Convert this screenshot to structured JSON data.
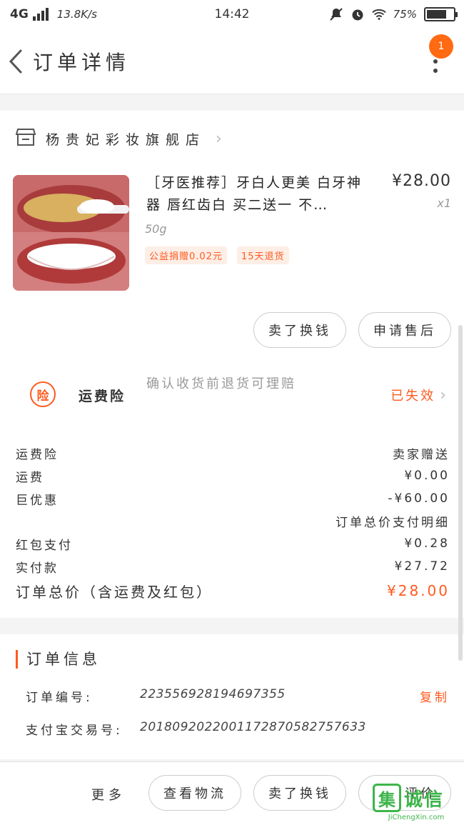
{
  "status_bar": {
    "network": "4G",
    "speed": "13.8K/s",
    "time": "14:42",
    "battery": "75%",
    "battery_level": 0.75
  },
  "header": {
    "title": "订单详情",
    "badge_count": "1",
    "accent": "#ff6a12"
  },
  "shop": {
    "name": "杨贵妃彩妆旗舰店"
  },
  "product": {
    "title": "［牙医推荐］牙白人更美 白牙神器 唇红齿白 买二送一 不…",
    "price": "¥28.00",
    "qty": "x1",
    "spec": "50g",
    "tags": [
      "公益捐赠0.02元",
      "15天退货"
    ]
  },
  "actions": {
    "sell_swap": "卖了换钱",
    "after_sale": "申请售后"
  },
  "insurance": {
    "icon_label": "险",
    "label": "运费险",
    "desc": "确认收货前退货可理赔",
    "status": "已失效"
  },
  "summary": {
    "rows": [
      {
        "label": "运费险",
        "value": "卖家赠送"
      },
      {
        "label": "运费",
        "value": "¥0.00"
      },
      {
        "label": "巨优惠",
        "value": "-¥60.00"
      }
    ],
    "detail_link": "订单总价支付明细",
    "rows2": [
      {
        "label": "红包支付",
        "value": "¥0.28"
      },
      {
        "label": "实付款",
        "value": "¥27.72"
      }
    ],
    "total_label": "订单总价（含运费及红包）",
    "total_value": "¥28.00"
  },
  "order_info": {
    "title": "订单信息",
    "order_no_label": "订单编号:",
    "order_no": "223556928194697355",
    "copy": "复制",
    "alipay_label": "支付宝交易号:",
    "alipay_no": "2018092022001172870582757633"
  },
  "bottom": {
    "more": "更多",
    "logistics": "查看物流",
    "sell_swap": "卖了换钱",
    "add_review": "追加评价"
  },
  "watermark": {
    "text": "诚信",
    "url": "JiChengXin.com"
  }
}
